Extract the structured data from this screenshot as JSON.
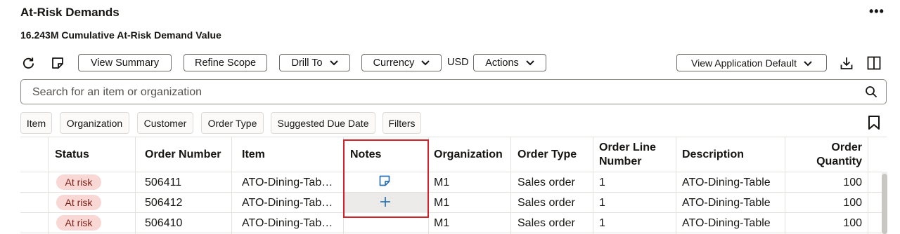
{
  "header": {
    "title": "At-Risk Demands",
    "more": "•••",
    "subtitle": "16.243M Cumulative At-Risk Demand Value"
  },
  "toolbar": {
    "view_summary": "View Summary",
    "refine_scope": "Refine Scope",
    "drill_to": "Drill To",
    "currency": "Currency",
    "currency_value": "USD",
    "actions": "Actions",
    "view_default": "View Application Default"
  },
  "search": {
    "placeholder": "Search for an item or organization"
  },
  "filters": [
    "Item",
    "Organization",
    "Customer",
    "Order Type",
    "Suggested Due Date",
    "Filters"
  ],
  "table": {
    "columns": {
      "status": "Status",
      "order_number": "Order Number",
      "item": "Item",
      "notes": "Notes",
      "organization": "Organization",
      "order_type": "Order Type",
      "order_line_number_1": "Order Line",
      "order_line_number_2": "Number",
      "description": "Description",
      "order_quantity_1": "Order",
      "order_quantity_2": "Quantity"
    },
    "rows": [
      {
        "status": "At risk",
        "order_number": "506411",
        "item": "ATO-Dining-Tab…",
        "notes_icon": "note-icon",
        "organization": "M1",
        "order_type": "Sales order",
        "order_line_number": "1",
        "description": "ATO-Dining-Table",
        "order_quantity": "100"
      },
      {
        "status": "At risk",
        "order_number": "506412",
        "item": "ATO-Dining-Tab…",
        "notes_icon": "add-icon",
        "organization": "M1",
        "order_type": "Sales order",
        "order_line_number": "1",
        "description": "ATO-Dining-Table",
        "order_quantity": "100"
      },
      {
        "status": "At risk",
        "order_number": "506410",
        "item": "ATO-Dining-Tab…",
        "notes_icon": "",
        "organization": "M1",
        "order_type": "Sales order",
        "order_line_number": "1",
        "description": "ATO-Dining-Table",
        "order_quantity": "100"
      }
    ]
  },
  "colors": {
    "badge_bg": "#f8d7d4",
    "badge_text": "#7a1e14",
    "highlight": "#d61f26",
    "icon_blue": "#2a6fb0"
  }
}
